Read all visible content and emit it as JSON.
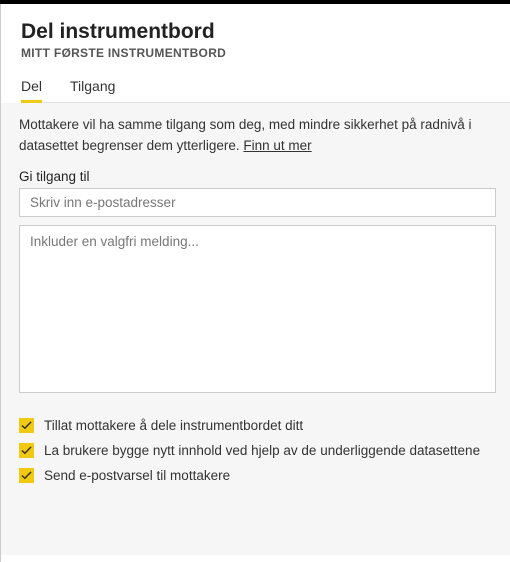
{
  "header": {
    "title": "Del instrumentbord",
    "subtitle": "MITT FØRSTE INSTRUMENTBORD"
  },
  "tabs": {
    "share": "Del",
    "access": "Tilgang"
  },
  "body": {
    "description": "Mottakere vil ha samme tilgang som deg, med mindre sikkerhet på radnivå i datasettet begrenser dem ytterligere.  ",
    "learn_more": "Finn ut mer",
    "grant_label": "Gi tilgang til",
    "email_placeholder": "Skriv inn e-postadresser",
    "message_placeholder": "Inkluder en valgfri melding..."
  },
  "options": {
    "allow_reshare": "Tillat mottakere å dele instrumentbordet ditt",
    "allow_build": "La brukere bygge nytt innhold ved hjelp av de underliggende datasettene",
    "send_email": "Send e-postvarsel til mottakere"
  }
}
